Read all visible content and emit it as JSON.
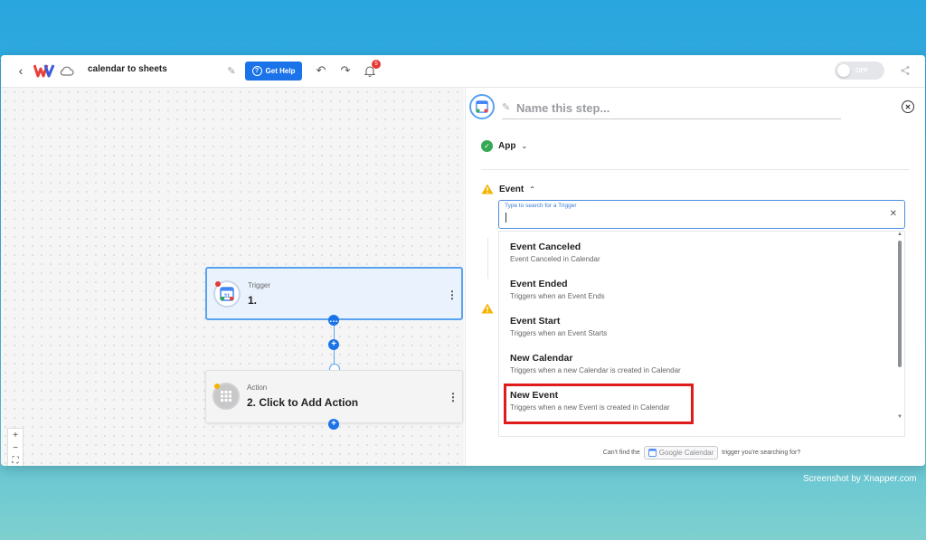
{
  "topbar": {
    "title": "calendar to sheets",
    "help_label": "Get Help",
    "notification_count": "5",
    "toggle_label": "OFF"
  },
  "canvas": {
    "trigger": {
      "type": "Trigger",
      "name": "1."
    },
    "action": {
      "type": "Action",
      "name": "2. Click to Add Action"
    },
    "zoom": {
      "in": "+",
      "out": "−",
      "fit": "⛶"
    }
  },
  "panel": {
    "name_placeholder": "Name this step...",
    "app_label": "App",
    "event_label": "Event",
    "search_label": "Type to search for a Trigger",
    "options": [
      {
        "title": "Event Canceled",
        "subtitle": "Event Canceled in Calendar"
      },
      {
        "title": "Event Ended",
        "subtitle": "Triggers when an Event Ends"
      },
      {
        "title": "Event Start",
        "subtitle": "Triggers when an Event Starts"
      },
      {
        "title": "New Calendar",
        "subtitle": "Triggers when a new Calendar is created in Calendar"
      },
      {
        "title": "New Event",
        "subtitle": "Triggers when a new Event is created in Calendar"
      }
    ],
    "footer": {
      "prefix": "Can't find the",
      "chip": "Google Calendar",
      "suffix": "trigger you're searching for?"
    }
  },
  "watermark": "Screenshot by Xnapper.com",
  "colors": {
    "accent": "#1a73e8",
    "highlight": "#e01b1b",
    "success": "#34a853",
    "warning": "#f4b400"
  }
}
